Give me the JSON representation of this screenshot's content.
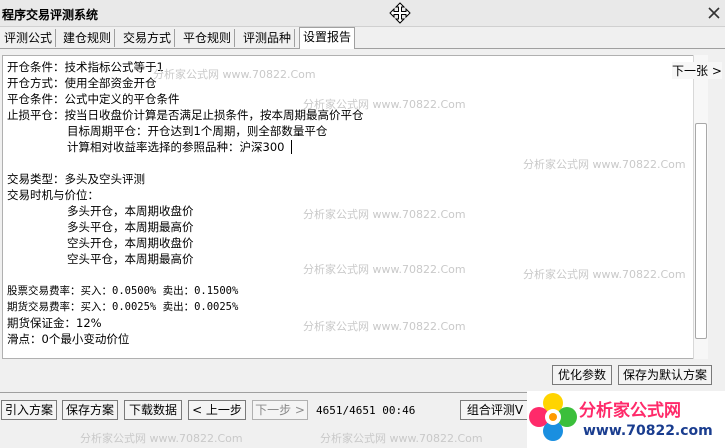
{
  "window": {
    "title": "程序交易评测系统"
  },
  "tabs": [
    {
      "label": "评测公式"
    },
    {
      "label": "建仓规则"
    },
    {
      "label": "交易方式"
    },
    {
      "label": "平仓规则"
    },
    {
      "label": "评测品种"
    },
    {
      "label": "设置报告"
    }
  ],
  "active_tab": "设置报告",
  "report": {
    "lines": [
      "开仓条件：技术指标公式等于1",
      "开仓方式：使用全部资金开仓",
      "平仓条件：公式中定义的平仓条件",
      "止损平仓：按当日收盘价计算是否满足止损条件，按本周期最高价平仓",
      "目标周期平仓：开仓达到1个周期，则全部数量平仓",
      "计算相对收益率选择的参照品种：沪深300",
      "交易类型：多头及空头评测",
      "交易时机与价位：",
      "多头开仓，本周期收盘价",
      "多头平仓，本周期最高价",
      "空头开仓，本周期收盘价",
      "空头平仓，本周期最高价",
      "股票交易费率：买入：0.0500%  卖出：0.1500%",
      "期货交易费率：买入：0.0025%  卖出：0.0025%",
      "期货保证金：12%",
      "滑点：0个最小变动价位"
    ]
  },
  "next_page_label": "下一张 >",
  "action_buttons": {
    "optimize": "优化参数",
    "save_default": "保存为默认方案"
  },
  "toolbar": {
    "import": "引入方案",
    "save": "保存方案",
    "download": "下载数据",
    "prev": "< 上一步",
    "next": "下一步 >",
    "combo": "组合评测V"
  },
  "status": {
    "progress": "4651/4651",
    "time": "00:46"
  },
  "watermark_text": "分析家公式网 www.70822.Com",
  "logo": {
    "brand": "分析家公式网",
    "url": "www.70822.com",
    "colors": {
      "pink": "#ff2a6a",
      "blue": "#1a3d8f",
      "yellow": "#ffd400",
      "green": "#3bbf3b"
    }
  }
}
